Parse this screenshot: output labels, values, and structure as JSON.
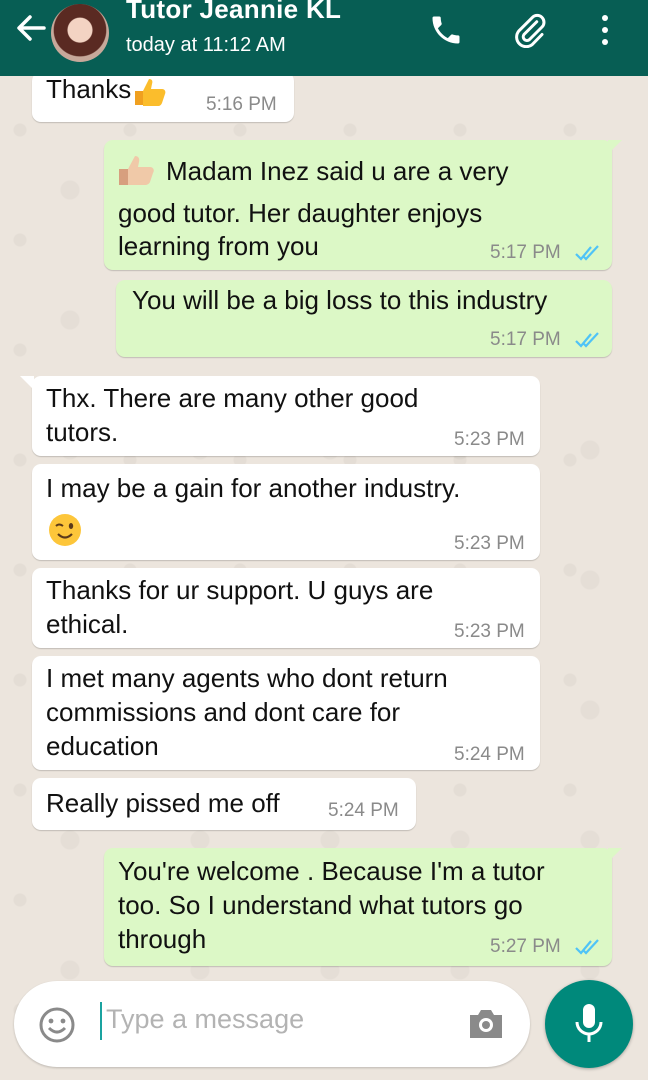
{
  "header": {
    "contact_name": "Tutor Jeannie KL",
    "last_seen": "today at 11:12 AM"
  },
  "icons": {
    "back": "arrow-left-icon",
    "call": "phone-icon",
    "attach": "paperclip-icon",
    "menu": "more-vert-icon",
    "emoji": "smiley-icon",
    "camera": "camera-icon",
    "mic": "microphone-icon"
  },
  "colors": {
    "header": "#075e54",
    "outgoing_bubble": "#dcf8c6",
    "incoming_bubble": "#ffffff",
    "read_ticks": "#4fc3f7",
    "mic_button": "#00897b"
  },
  "messages": [
    {
      "dir": "in",
      "lines": [
        "Thanks"
      ],
      "time": "5:16 PM",
      "emoji_after": "thumbs-up"
    },
    {
      "dir": "out",
      "lines": [
        "Madam Inez said u are a very",
        "good tutor. Her daughter enjoys",
        "learning from you"
      ],
      "time": "5:17 PM",
      "emoji_before": "thumbs-up",
      "status": "read"
    },
    {
      "dir": "out",
      "lines": [
        "You will be a big loss to this industry"
      ],
      "time": "5:17 PM",
      "status": "read"
    },
    {
      "dir": "in",
      "lines": [
        "Thx. There are many other good",
        "tutors."
      ],
      "time": "5:23 PM"
    },
    {
      "dir": "in",
      "lines": [
        "I may be a gain for another industry."
      ],
      "time": "5:23 PM",
      "emoji_line": "winking-face"
    },
    {
      "dir": "in",
      "lines": [
        "Thanks for ur support. U guys are",
        "ethical."
      ],
      "time": "5:23 PM"
    },
    {
      "dir": "in",
      "lines": [
        "I met many agents who dont return",
        "commissions and dont care for",
        "education"
      ],
      "time": "5:24 PM"
    },
    {
      "dir": "in",
      "lines": [
        "Really pissed me off"
      ],
      "time": "5:24 PM"
    },
    {
      "dir": "out",
      "lines": [
        "You're welcome . Because I'm a tutor",
        "too. So I understand what tutors go",
        "through"
      ],
      "time": "5:27 PM",
      "status": "read"
    }
  ],
  "composer": {
    "placeholder": "Type a message"
  }
}
